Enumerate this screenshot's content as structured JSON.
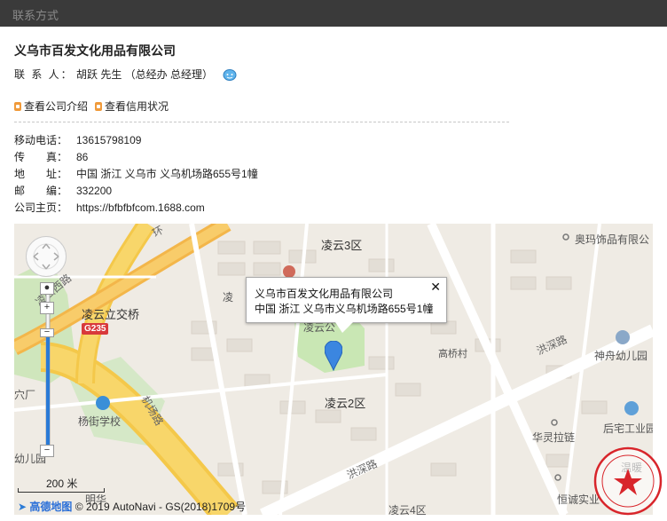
{
  "header": {
    "title": "联系方式"
  },
  "company": {
    "name": "义乌市百发文化用品有限公司",
    "contact_label": "联 系 人：",
    "contact_value": "胡跃 先生 （总经办 总经理）"
  },
  "links": {
    "intro": "查看公司介绍",
    "credit": "查看信用状况"
  },
  "info": [
    {
      "key": "移动电话：",
      "value": "13615798109"
    },
    {
      "key": "传　　真：",
      "value": "86"
    },
    {
      "key": "地　　址：",
      "value": "中国 浙江 义乌市 义乌机场路655号1幢"
    },
    {
      "key": "邮　　编：",
      "value": "332200"
    },
    {
      "key": "公司主页：",
      "value": "https://bfbfbfcom.1688.com"
    }
  ],
  "map": {
    "popup_line1": "义乌市百发文化用品有限公司",
    "popup_line2": "中国 浙江 义乌市义乌机场路655号1幢",
    "close": "✕",
    "labels": {
      "lingyun3": "凌云3区",
      "lingyun2": "凌云2区",
      "lingyun_overpass": "凌云立交桥",
      "yangjie": "杨街学校",
      "aoma": "奥玛饰品有限公",
      "shenzhou": "神舟幼儿园",
      "huali": "华灵拉链",
      "houzhai": "后宅工业园",
      "wenxuan": "温暖",
      "hengcheng": "恒诚实业",
      "gaoqiao": "高桥村",
      "hongshen1": "洪深路",
      "hongshen2": "洪深路",
      "jichang": "机场路",
      "lingyun_w": "凌云西路",
      "huan": "环",
      "chuanchang": "穴厂",
      "youer": "幼儿园",
      "lingyun4": "凌云4区",
      "lingyun_g": "凌云公",
      "lingyun_f": "凌",
      "minghua": "明华",
      "g235": "G235"
    },
    "scale": "200 米",
    "copyright": "© 2019 AutoNavi - GS(2018)1709号",
    "logo_text": "高德地图"
  }
}
